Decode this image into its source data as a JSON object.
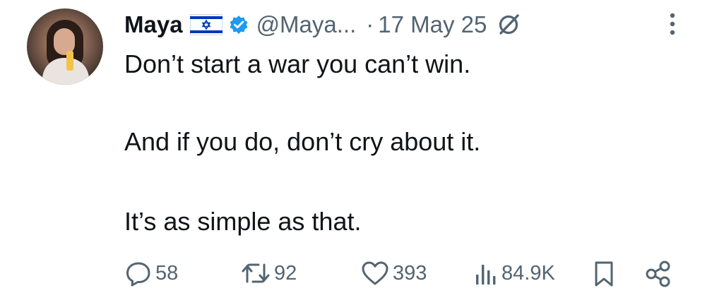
{
  "post": {
    "author_name": "Maya",
    "handle": "@Maya...",
    "separator": "·",
    "date": "17 May 25",
    "lines": [
      "Don’t start a war you can’t win.",
      "And if you do, don’t cry about it.",
      "It’s as simple as that."
    ]
  },
  "icons": {
    "flag": "israel-flag-icon",
    "verified": "verified-badge-icon",
    "grok": "grok-icon",
    "more": "more-options-icon",
    "reply": "reply-icon",
    "repost": "repost-icon",
    "like": "like-icon",
    "views": "views-icon",
    "bookmark": "bookmark-icon",
    "share": "share-icon"
  },
  "actions": {
    "replies": "58",
    "reposts": "92",
    "likes": "393",
    "views": "84.9K"
  },
  "colors": {
    "text": "#0f1419",
    "secondary": "#536471",
    "verified": "#1d9bf0",
    "flag_blue": "#0038b8"
  }
}
